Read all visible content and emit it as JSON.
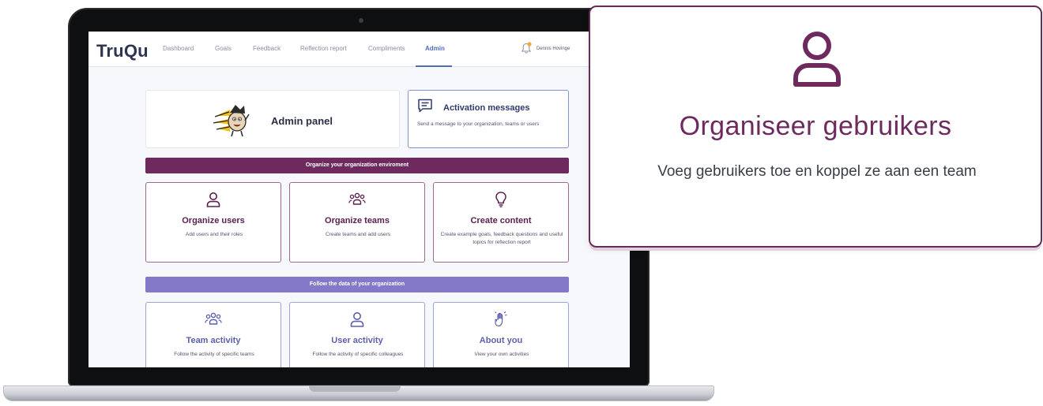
{
  "app": {
    "logo": "TruQu",
    "nav": [
      "Dashboard",
      "Goals",
      "Feedback",
      "Reflection report",
      "Compliments",
      "Admin"
    ],
    "active_nav": "Admin",
    "user_name": "Dennis Hovinge",
    "bell_icon": "bell-icon",
    "notification_color": "#f2a93b"
  },
  "admin_panel": {
    "title": "Admin panel"
  },
  "activation": {
    "title": "Activation messages",
    "description": "Send a message to your organization, teams or users",
    "icon": "chat-icon"
  },
  "sections": {
    "organize": {
      "label": "Organize your organization enviroment",
      "color": "#6e2a5e",
      "tiles": [
        {
          "icon": "user-icon",
          "title": "Organize users",
          "description": "Add users and their roles"
        },
        {
          "icon": "team-icon",
          "title": "Organize teams",
          "description": "Create teams and add users"
        },
        {
          "icon": "lightbulb-icon",
          "title": "Create content",
          "description": "Create example goals, feedback questions and useful topics for reflection report"
        }
      ]
    },
    "follow": {
      "label": "Follow the data of your organization",
      "color": "#8479c9",
      "tiles": [
        {
          "icon": "team-icon",
          "title": "Team activity",
          "description": "Follow the activity of specific teams"
        },
        {
          "icon": "user-icon",
          "title": "User activity",
          "description": "Follow the activity of specific colleagues"
        },
        {
          "icon": "hand-wave-icon",
          "title": "About you",
          "description": "View your own activities"
        }
      ]
    }
  },
  "callout": {
    "icon": "user-icon",
    "title": "Organiseer gebruikers",
    "description": "Voeg gebruikers toe en koppel ze aan een team",
    "accent": "#6e2a5e"
  }
}
